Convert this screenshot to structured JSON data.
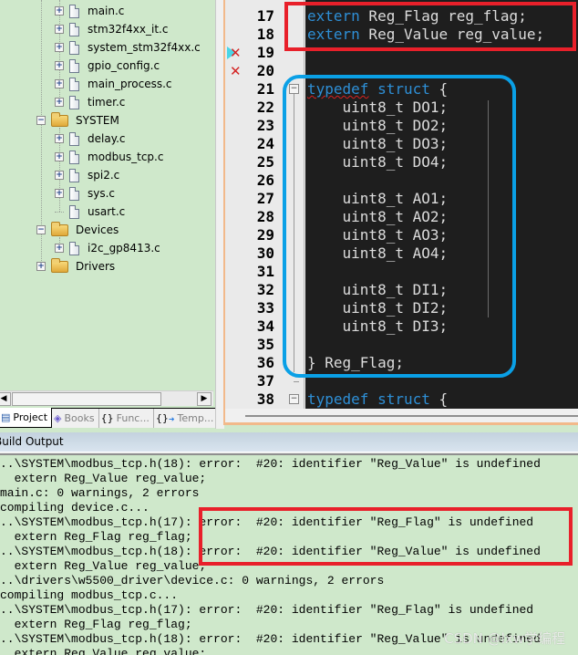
{
  "project_tree": {
    "items": [
      {
        "label": "main.c",
        "type": "file",
        "expandable": true
      },
      {
        "label": "stm32f4xx_it.c",
        "type": "file",
        "expandable": true
      },
      {
        "label": "system_stm32f4xx.c",
        "type": "file",
        "expandable": true
      },
      {
        "label": "gpio_config.c",
        "type": "file",
        "expandable": true
      },
      {
        "label": "main_process.c",
        "type": "file",
        "expandable": true
      },
      {
        "label": "timer.c",
        "type": "file",
        "expandable": true
      },
      {
        "label": "SYSTEM",
        "type": "folder",
        "expanded": true
      },
      {
        "label": "delay.c",
        "type": "file",
        "expandable": true
      },
      {
        "label": "modbus_tcp.c",
        "type": "file",
        "expandable": true
      },
      {
        "label": "spi2.c",
        "type": "file",
        "expandable": true
      },
      {
        "label": "sys.c",
        "type": "file",
        "expandable": true
      },
      {
        "label": "usart.c",
        "type": "file",
        "expandable": false
      },
      {
        "label": "Devices",
        "type": "folder",
        "expanded": true
      },
      {
        "label": "i2c_gp8413.c",
        "type": "file",
        "expandable": true
      },
      {
        "label": "Drivers",
        "type": "folder",
        "expanded": false
      }
    ]
  },
  "pane_tabs": [
    {
      "label": "Project",
      "icon": "project-icon",
      "active": true
    },
    {
      "label": "Books",
      "icon": "books-icon",
      "active": false
    },
    {
      "label": "Func...",
      "icon": "functions-icon",
      "active": false
    },
    {
      "label": "Temp...",
      "icon": "templates-icon",
      "active": false
    }
  ],
  "editor": {
    "lines": [
      {
        "num": "17",
        "parts": [
          [
            "kw",
            "extern"
          ],
          [
            "txt",
            " Reg_Flag reg_flag;"
          ]
        ]
      },
      {
        "num": "18",
        "parts": [
          [
            "kw",
            "extern"
          ],
          [
            "txt",
            " Reg_Value reg_value;"
          ]
        ]
      },
      {
        "num": "19",
        "parts": [],
        "marker": "cursor-error"
      },
      {
        "num": "20",
        "parts": [],
        "marker": "error"
      },
      {
        "num": "21",
        "parts": [
          [
            "kwsq",
            "typedef"
          ],
          [
            "txt",
            " "
          ],
          [
            "kw",
            "struct"
          ],
          [
            "txt",
            " {"
          ]
        ],
        "fold": true
      },
      {
        "num": "22",
        "parts": [
          [
            "txt",
            "    uint8_t DO1;"
          ]
        ]
      },
      {
        "num": "23",
        "parts": [
          [
            "txt",
            "    uint8_t DO2;"
          ]
        ]
      },
      {
        "num": "24",
        "parts": [
          [
            "txt",
            "    uint8_t DO3;"
          ]
        ]
      },
      {
        "num": "25",
        "parts": [
          [
            "txt",
            "    uint8_t DO4;"
          ]
        ]
      },
      {
        "num": "26",
        "parts": []
      },
      {
        "num": "27",
        "parts": [
          [
            "txt",
            "    uint8_t AO1;"
          ]
        ]
      },
      {
        "num": "28",
        "parts": [
          [
            "txt",
            "    uint8_t AO2;"
          ]
        ]
      },
      {
        "num": "29",
        "parts": [
          [
            "txt",
            "    uint8_t AO3;"
          ]
        ]
      },
      {
        "num": "30",
        "parts": [
          [
            "txt",
            "    uint8_t AO4;"
          ]
        ]
      },
      {
        "num": "31",
        "parts": []
      },
      {
        "num": "32",
        "parts": [
          [
            "txt",
            "    uint8_t DI1;"
          ]
        ]
      },
      {
        "num": "33",
        "parts": [
          [
            "txt",
            "    uint8_t DI2;"
          ]
        ]
      },
      {
        "num": "34",
        "parts": [
          [
            "txt",
            "    uint8_t DI3;"
          ]
        ]
      },
      {
        "num": "35",
        "parts": []
      },
      {
        "num": "36",
        "parts": [
          [
            "txt",
            "} Reg_Flag;"
          ]
        ]
      },
      {
        "num": "37",
        "parts": []
      },
      {
        "num": "38",
        "parts": [
          [
            "kw",
            "typedef"
          ],
          [
            "txt",
            " "
          ],
          [
            "kw",
            "struct"
          ],
          [
            "txt",
            " {"
          ]
        ],
        "fold": true
      }
    ]
  },
  "build_output": {
    "title": "Build Output",
    "lines": [
      "..\\SYSTEM\\modbus_tcp.h(18): error:  #20: identifier \"Reg_Value\" is undefined",
      "  extern Reg_Value reg_value;",
      "main.c: 0 warnings, 2 errors",
      "compiling device.c...",
      "..\\SYSTEM\\modbus_tcp.h(17): error:  #20: identifier \"Reg_Flag\" is undefined",
      "  extern Reg_Flag reg_flag;",
      "..\\SYSTEM\\modbus_tcp.h(18): error:  #20: identifier \"Reg_Value\" is undefined",
      "  extern Reg_Value reg_value;",
      "..\\drivers\\w5500_driver\\device.c: 0 warnings, 2 errors",
      "compiling modbus_tcp.c...",
      "..\\SYSTEM\\modbus_tcp.h(17): error:  #20: identifier \"Reg_Flag\" is undefined",
      "  extern Reg_Flag reg_flag;",
      "..\\SYSTEM\\modbus_tcp.h(18): error:  #20: identifier \"Reg_Value\" is undefined",
      "  extern Reg_Value reg_value;"
    ]
  },
  "watermark": "CSDN @lxw学编程",
  "colors": {
    "annotation_red": "#e8202a",
    "annotation_blue": "#0aa0e6",
    "keyword_blue": "#2e8fd6",
    "editor_bg": "#1e1e1e",
    "pane_bg": "#cfe8cb"
  }
}
